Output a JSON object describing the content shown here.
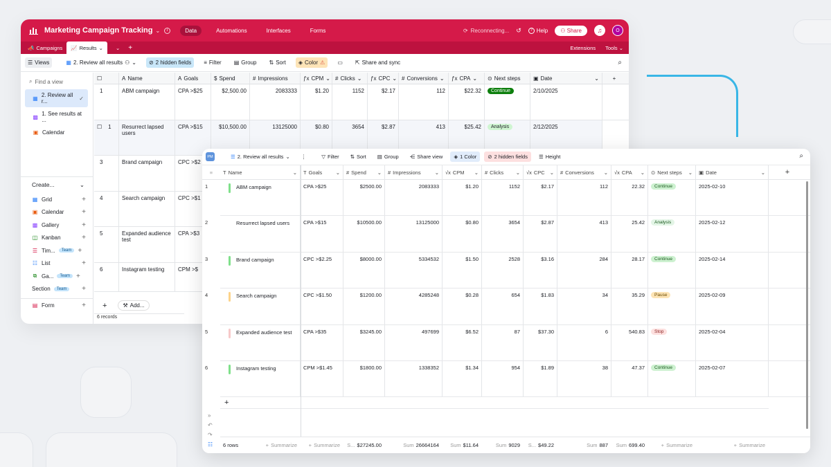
{
  "colors": {
    "brand": "#d51a49",
    "accent": "#39b6e6"
  },
  "win1": {
    "base_name": "Marketing Campaign Tracking",
    "nav": [
      "Data",
      "Automations",
      "Interfaces",
      "Forms"
    ],
    "status": "Reconnecting...",
    "help": "Help",
    "share": "Share",
    "avatar": "O",
    "tabs": [
      "Campaigns",
      "Results"
    ],
    "extensions": "Extensions",
    "tools": "Tools",
    "toolbar": {
      "views": "Views",
      "view_name": "2. Review all results",
      "hidden": "2 hidden fields",
      "filter": "Filter",
      "group": "Group",
      "sort": "Sort",
      "color": "Color",
      "share_sync": "Share and sync"
    },
    "sidebar": {
      "find": "Find a view",
      "views": [
        {
          "label": "2. Review all r...",
          "icon": "grid-icon"
        },
        {
          "label": "1. See results at ...",
          "icon": "gallery-icon"
        },
        {
          "label": "Calendar",
          "icon": "calendar-icon"
        }
      ],
      "create": "Create...",
      "create_items": [
        {
          "label": "Grid",
          "icon": "grid-icon"
        },
        {
          "label": "Calendar",
          "icon": "calendar-icon"
        },
        {
          "label": "Gallery",
          "icon": "gallery-icon"
        },
        {
          "label": "Kanban",
          "icon": "kanban-icon"
        },
        {
          "label": "Tim...",
          "icon": "timeline-icon",
          "badge": "Team"
        },
        {
          "label": "List",
          "icon": "list-icon"
        },
        {
          "label": "Ga...",
          "icon": "gantt-icon",
          "badge": "Team"
        }
      ],
      "section": "Section",
      "section_badge": "Team",
      "form": "Form"
    },
    "columns": [
      "Name",
      "Goals",
      "Spend",
      "Impressions",
      "CPM",
      "Clicks",
      "CPC",
      "Conversions",
      "CPA",
      "Next steps",
      "Date"
    ],
    "rows": [
      {
        "n": "1",
        "name": "ABM campaign",
        "goals": "CPA >$25",
        "spend": "$2,500.00",
        "imp": "2083333",
        "cpm": "$1.20",
        "clicks": "1152",
        "cpc": "$2.17",
        "conv": "112",
        "cpa": "$22.32",
        "next": "Continue",
        "date": "2/10/2025"
      },
      {
        "n": "1",
        "name": "Resurrect lapsed users",
        "goals": "CPA >$15",
        "spend": "$10,500.00",
        "imp": "13125000",
        "cpm": "$0.80",
        "clicks": "3654",
        "cpc": "$2.87",
        "conv": "413",
        "cpa": "$25.42",
        "next": "Analysis",
        "date": "2/12/2025"
      },
      {
        "n": "3",
        "name": "Brand campaign",
        "goals": "CPC >$2"
      },
      {
        "n": "4",
        "name": "Search campaign",
        "goals": "CPC >$1"
      },
      {
        "n": "5",
        "name": "Expanded audience test",
        "goals": "CPA >$3"
      },
      {
        "n": "6",
        "name": "Instagram testing",
        "goals": "CPM >$"
      }
    ],
    "add": "Add...",
    "records": "6 records"
  },
  "win2": {
    "pm": "PM",
    "toolbar": {
      "view": "2. Review all results",
      "filter": "Filter",
      "sort": "Sort",
      "group": "Group",
      "share": "Share view",
      "color": "1 Color",
      "hidden": "2 hidden fields",
      "height": "Height"
    },
    "columns": [
      "Name",
      "Goals",
      "Spend",
      "Impressions",
      "CPM",
      "Clicks",
      "CPC",
      "Conversions",
      "CPA",
      "Next steps",
      "Date"
    ],
    "rows": [
      {
        "n": "1",
        "name": "ABM campaign",
        "goals": "CPA >$25",
        "spend": "$2500.00",
        "imp": "2083333",
        "cpm": "$1.20",
        "clicks": "1152",
        "cpc": "$2.17",
        "conv": "112",
        "cpa": "22.32",
        "next": "Continue",
        "date": "2025-02-10",
        "bar": "#7fe08a"
      },
      {
        "n": "2",
        "name": "Resurrect lapsed users",
        "goals": "CPA >$15",
        "spend": "$10500.00",
        "imp": "13125000",
        "cpm": "$0.80",
        "clicks": "3654",
        "cpc": "$2.87",
        "conv": "413",
        "cpa": "25.42",
        "next": "Analysis",
        "date": "2025-02-12",
        "bar": "#ffffff"
      },
      {
        "n": "3",
        "name": "Brand campaign",
        "goals": "CPC >$2.25",
        "spend": "$8000.00",
        "imp": "5334532",
        "cpm": "$1.50",
        "clicks": "2528",
        "cpc": "$3.16",
        "conv": "284",
        "cpa": "28.17",
        "next": "Continue",
        "date": "2025-02-14",
        "bar": "#7fe08a"
      },
      {
        "n": "4",
        "name": "Search campaign",
        "goals": "CPC >$1.50",
        "spend": "$1200.00",
        "imp": "4285248",
        "cpm": "$0.28",
        "clicks": "654",
        "cpc": "$1.83",
        "conv": "34",
        "cpa": "35.29",
        "next": "Pause",
        "date": "2025-02-09",
        "bar": "#fcd38a"
      },
      {
        "n": "5",
        "name": "Expanded audience test",
        "goals": "CPA >$35",
        "spend": "$3245.00",
        "imp": "497699",
        "cpm": "$6.52",
        "clicks": "87",
        "cpc": "$37.30",
        "conv": "6",
        "cpa": "540.83",
        "next": "Stop",
        "date": "2025-02-04",
        "bar": "#f7c9c9"
      },
      {
        "n": "6",
        "name": "Instagram testing",
        "goals": "CPM >$1.45",
        "spend": "$1800.00",
        "imp": "1338352",
        "cpm": "$1.34",
        "clicks": "954",
        "cpc": "$1.89",
        "conv": "38",
        "cpa": "47.37",
        "next": "Continue",
        "date": "2025-02-07",
        "bar": "#7fe08a"
      }
    ],
    "footer": {
      "rows": "6 rows",
      "summarize": "Summarize",
      "s_short": "S...",
      "sum": "Sum",
      "spend": "$27245.00",
      "imp": "26664164",
      "cpm": "$11.64",
      "clicks": "9029",
      "cpc": "$49.22",
      "conv": "887",
      "cpa": "699.40"
    }
  }
}
